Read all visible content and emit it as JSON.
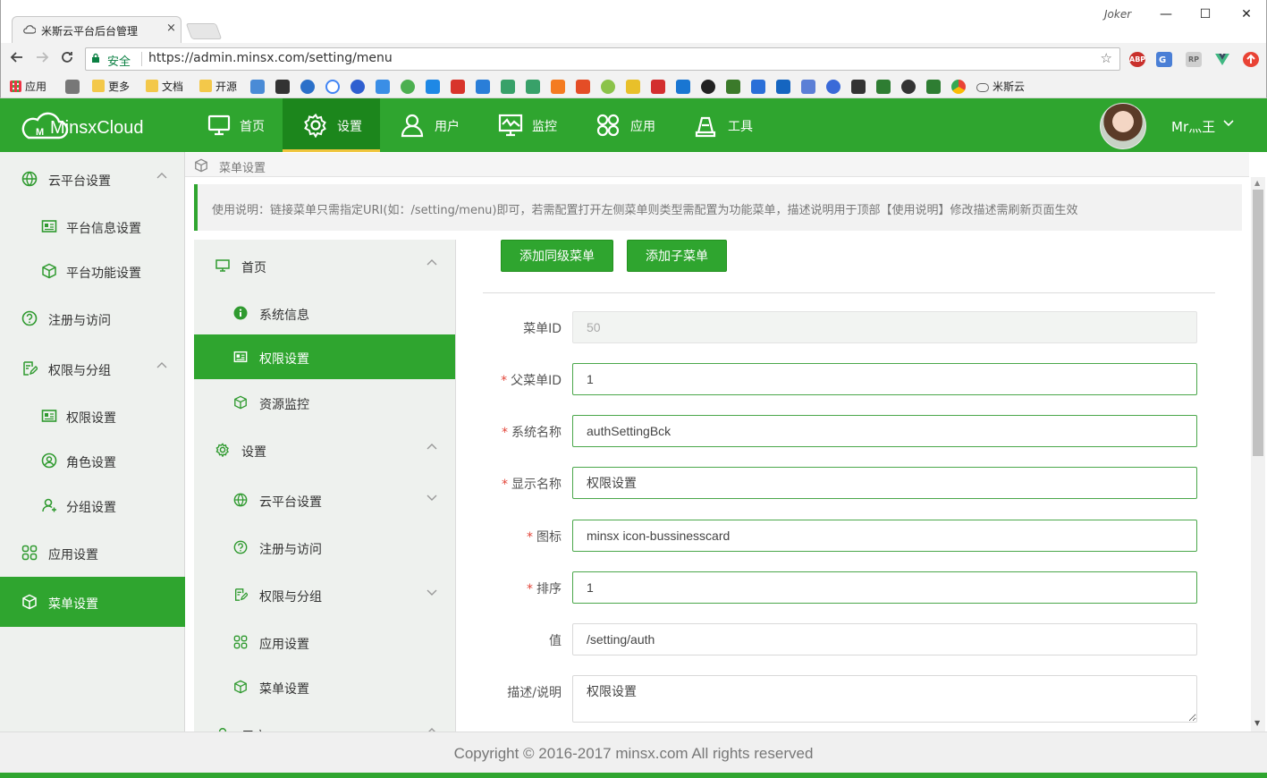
{
  "browser": {
    "tab_title": "米斯云平台后台管理",
    "tab_close": "×",
    "window_user": "Joker",
    "url_secure": "安全",
    "url": "https://admin.minsx.com/setting/menu",
    "win_minimize": "—",
    "win_maximize": "☐",
    "win_close": "✕",
    "bookmarks": [
      "应用",
      "更多",
      "文档",
      "开源",
      "米斯云"
    ],
    "extensions": [
      "ABP",
      "translate",
      "RP",
      "vue",
      "stop"
    ]
  },
  "header": {
    "logo": "MinsxCloud",
    "nav": [
      {
        "label": "首页",
        "icon": "monitor-icon"
      },
      {
        "label": "设置",
        "icon": "gear-icon"
      },
      {
        "label": "用户",
        "icon": "user-icon"
      },
      {
        "label": "监控",
        "icon": "monitor-chart-icon"
      },
      {
        "label": "应用",
        "icon": "apps-icon"
      },
      {
        "label": "工具",
        "icon": "tools-icon"
      }
    ],
    "active_nav": "设置",
    "username": "Mr灬王",
    "chevron": "v"
  },
  "sidebar": {
    "items": [
      {
        "label": "云平台设置",
        "icon": "globe-icon",
        "expandable": true
      },
      {
        "label": "平台信息设置",
        "icon": "card-icon",
        "child": true
      },
      {
        "label": "平台功能设置",
        "icon": "cube-icon",
        "child": true
      },
      {
        "label": "注册与访问",
        "icon": "question-icon"
      },
      {
        "label": "权限与分组",
        "icon": "doc-edit-icon",
        "expandable": true
      },
      {
        "label": "权限设置",
        "icon": "card-icon",
        "child": true
      },
      {
        "label": "角色设置",
        "icon": "person-circle-icon",
        "child": true
      },
      {
        "label": "分组设置",
        "icon": "person-icon",
        "child": true
      },
      {
        "label": "应用设置",
        "icon": "apps-icon"
      },
      {
        "label": "菜单设置",
        "icon": "cube-icon",
        "active": true
      }
    ]
  },
  "breadcrumb": "菜单设置",
  "notice": "使用说明：链接菜单只需指定URI(如：/setting/menu)即可，若需配置打开左侧菜单则类型需配置为功能菜单，描述说明用于顶部【使用说明】修改描述需刷新页面生效",
  "tree": {
    "items": [
      {
        "label": "首页",
        "icon": "monitor-icon",
        "level": 0,
        "chevron": "up"
      },
      {
        "label": "系统信息",
        "icon": "info-icon",
        "level": 1
      },
      {
        "label": "权限设置",
        "icon": "card-icon",
        "level": 1,
        "active": true
      },
      {
        "label": "资源监控",
        "icon": "cube-icon",
        "level": 1
      },
      {
        "label": "设置",
        "icon": "gear-icon",
        "level": 0,
        "chevron": "up"
      },
      {
        "label": "云平台设置",
        "icon": "globe-icon",
        "level": 1,
        "chevron": "down"
      },
      {
        "label": "注册与访问",
        "icon": "question-icon",
        "level": 1
      },
      {
        "label": "权限与分组",
        "icon": "doc-edit-icon",
        "level": 1,
        "chevron": "down"
      },
      {
        "label": "应用设置",
        "icon": "apps-icon",
        "level": 1
      },
      {
        "label": "菜单设置",
        "icon": "cube-icon",
        "level": 1
      },
      {
        "label": "用户",
        "icon": "user-icon",
        "level": 0,
        "chevron": "up"
      }
    ]
  },
  "buttons": {
    "add_sibling": "添加同级菜单",
    "add_child": "添加子菜单"
  },
  "form": {
    "fields": [
      {
        "label": "菜单ID",
        "value": "50",
        "required": false,
        "disabled": true
      },
      {
        "label": "父菜单ID",
        "value": "1",
        "required": true
      },
      {
        "label": "系统名称",
        "value": "authSettingBck",
        "required": true
      },
      {
        "label": "显示名称",
        "value": "权限设置",
        "required": true
      },
      {
        "label": "图标",
        "value": "minsx icon-bussinesscard",
        "required": true
      },
      {
        "label": "排序",
        "value": "1",
        "required": true
      },
      {
        "label": "值",
        "value": "/setting/auth",
        "required": false
      },
      {
        "label": "描述/说明",
        "value": "权限设置",
        "required": false,
        "textarea": true
      }
    ],
    "required_mark": "*"
  },
  "footer": {
    "copyright": "Copyright © 2016-2017 minsx.com All rights reserved"
  },
  "colors": {
    "brand": "#2fa52f",
    "brand_dark": "#1c861c",
    "accent": "#f0c53c",
    "required": "#e3463a"
  }
}
